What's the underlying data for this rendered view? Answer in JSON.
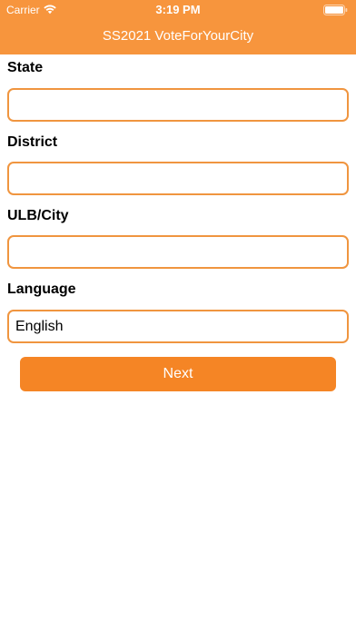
{
  "status_bar": {
    "carrier": "Carrier",
    "time": "3:19 PM",
    "wifi_icon": "wifi-icon",
    "battery_icon": "battery-icon"
  },
  "header": {
    "title": "SS2021 VoteForYourCity",
    "background_color": "#f7953d"
  },
  "form": {
    "state": {
      "label": "State",
      "value": ""
    },
    "district": {
      "label": "District",
      "value": ""
    },
    "city": {
      "label": "ULB/City",
      "value": ""
    },
    "language": {
      "label": "Language",
      "value": "English"
    },
    "input_border_color": "#f0953f"
  },
  "next_button": {
    "label": "Next",
    "color": "#f58525"
  }
}
